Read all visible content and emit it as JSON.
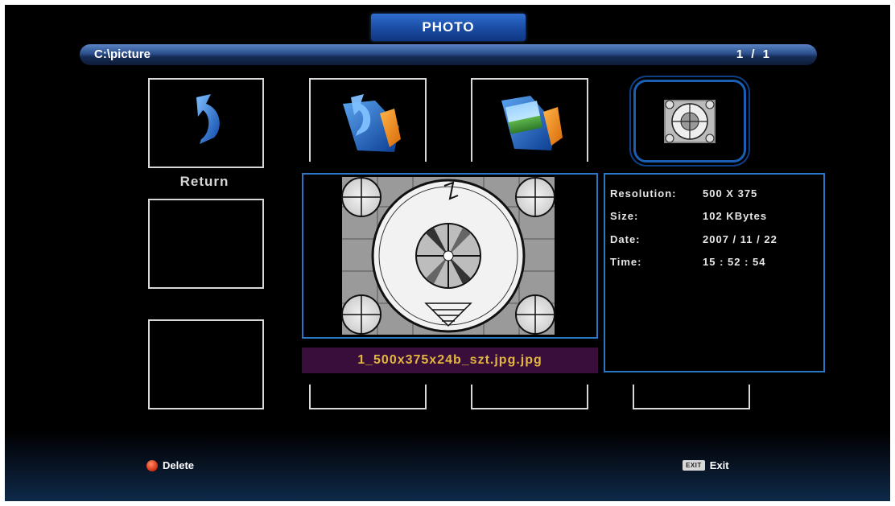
{
  "header": {
    "title": "PHOTO"
  },
  "pathbar": {
    "path": "C:\\picture",
    "page": "1 / 1"
  },
  "tiles": {
    "return_label": "Return"
  },
  "info": {
    "resolution_label": "Resolution:",
    "resolution_value": "500 X 375",
    "size_label": "Size:",
    "size_value": "102 KBytes",
    "date_label": "Date:",
    "date_value": "2007 / 11 / 22",
    "time_label": "Time:",
    "time_value": "15 : 52 : 54"
  },
  "filename": "1_500x375x24b_szt.jpg.jpg",
  "footer": {
    "delete_label": "Delete",
    "exit_key": "EXIT",
    "exit_label": "Exit"
  },
  "colors": {
    "accent_blue": "#2a78c4",
    "filename_bg": "#3a0e3a",
    "filename_text": "#e2b640",
    "delete_dot": "#d83a1a"
  },
  "icons": [
    "return-arrow-icon",
    "folder-up-icon",
    "folder-photo-icon",
    "test-pattern-thumbnail",
    "red-button-icon",
    "exit-key-icon"
  ]
}
